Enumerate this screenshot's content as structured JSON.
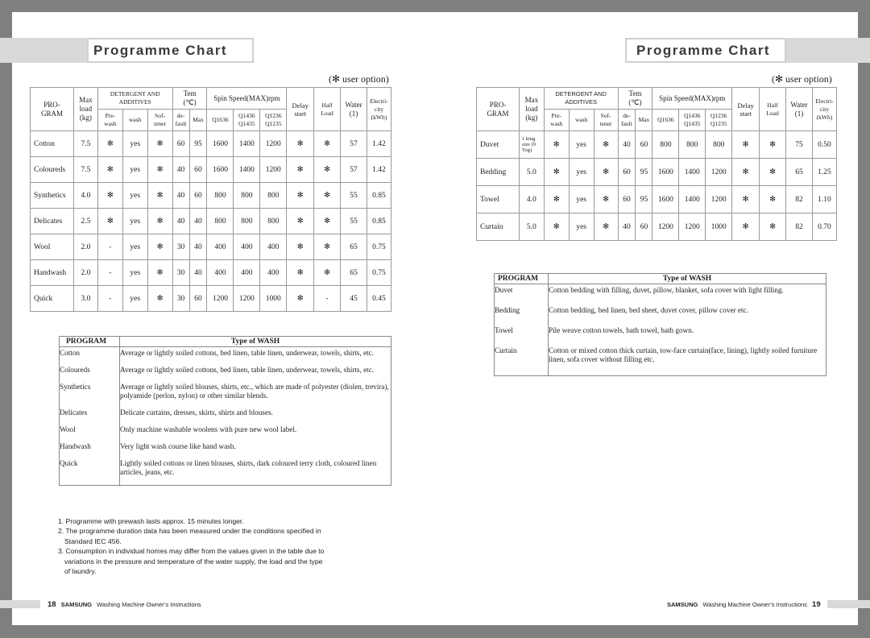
{
  "left_page": {
    "title": "Programme Chart",
    "user_option": "(✻ user option)",
    "header": {
      "program": "PRO-\nGRAM",
      "max_load": "Max load (kg)",
      "detergent": "DETERGENT AND ADDITIVES",
      "prewash": "Pre- wash",
      "wash": "wash",
      "softener": "Sof- tener",
      "temp": "Tem (℃)",
      "default": "de- fault",
      "max": "Max",
      "spin": "Spin Speed(MAX)rpm",
      "q1636": "Q1636",
      "q1436": "Q1436 Q1435",
      "q1236": "Q1236 Q1235",
      "delay": "Delay start",
      "half": "Half Load",
      "water": "Water (1)",
      "electricity": "Electri- city (kWh)"
    },
    "rows": [
      {
        "program": "Cotton",
        "load": "7.5",
        "prewash": "✻",
        "wash": "yes",
        "softener": "✻",
        "t_default": "60",
        "t_max": "95",
        "q1636": "1600",
        "q1436": "1400",
        "q1236": "1200",
        "delay": "✻",
        "half": "✻",
        "water": "57",
        "elec": "1.42"
      },
      {
        "program": "Coloureds",
        "load": "7.5",
        "prewash": "✻",
        "wash": "yes",
        "softener": "✻",
        "t_default": "40",
        "t_max": "60",
        "q1636": "1600",
        "q1436": "1400",
        "q1236": "1200",
        "delay": "✻",
        "half": "✻",
        "water": "57",
        "elec": "1.42"
      },
      {
        "program": "Synthetics",
        "load": "4.0",
        "prewash": "✻",
        "wash": "yes",
        "softener": "✻",
        "t_default": "40",
        "t_max": "60",
        "q1636": "800",
        "q1436": "800",
        "q1236": "800",
        "delay": "✻",
        "half": "✻",
        "water": "55",
        "elec": "0.85"
      },
      {
        "program": "Delicates",
        "load": "2.5",
        "prewash": "✻",
        "wash": "yes",
        "softener": "✻",
        "t_default": "40",
        "t_max": "40",
        "q1636": "800",
        "q1436": "800",
        "q1236": "800",
        "delay": "✻",
        "half": "✻",
        "water": "55",
        "elec": "0.85"
      },
      {
        "program": "Wool",
        "load": "2.0",
        "prewash": "-",
        "wash": "yes",
        "softener": "✻",
        "t_default": "30",
        "t_max": "40",
        "q1636": "400",
        "q1436": "400",
        "q1236": "400",
        "delay": "✻",
        "half": "✻",
        "water": "65",
        "elec": "0.75"
      },
      {
        "program": "Handwash",
        "load": "2.0",
        "prewash": "-",
        "wash": "yes",
        "softener": "✻",
        "t_default": "30",
        "t_max": "40",
        "q1636": "400",
        "q1436": "400",
        "q1236": "400",
        "delay": "✻",
        "half": "✻",
        "water": "65",
        "elec": "0.75"
      },
      {
        "program": "Quick",
        "load": "3.0",
        "prewash": "-",
        "wash": "yes",
        "softener": "✻",
        "t_default": "30",
        "t_max": "60",
        "q1636": "1200",
        "q1436": "1200",
        "q1236": "1000",
        "delay": "✻",
        "half": "-",
        "water": "45",
        "elec": "0.45"
      }
    ],
    "wash_table": {
      "col_program": "PROGRAM",
      "col_type": "Type of  WASH",
      "rows": [
        {
          "program": "Cotton",
          "desc": "Average or lightly soiled cottons, bed linen, table linen, underwear, towels, shirts, etc."
        },
        {
          "program": "Coloureds",
          "desc": "Average or lightly soiled cottons, bed linen, table linen, underwear, towels, shirts, etc."
        },
        {
          "program": "Synthetics",
          "desc": "Average or lightly soiled blouses, shirts, etc., which are made of polyester (diolen, trevira), polyamide (perlon, nylon) or other similar blends."
        },
        {
          "program": "Delicates",
          "desc": "Delicate curtains, dresses, skirts, shirts and blouses."
        },
        {
          "program": "Wool",
          "desc": "Only machine washable woolens with pure new wool label."
        },
        {
          "program": "Handwash",
          "desc": "Very light wash course like hand wash."
        },
        {
          "program": "Quick",
          "desc": "Lightly soiled cottons or linen blouses, shirts, dark coloured terry cloth, coloured linen articles, jeans, etc."
        }
      ]
    },
    "notes": [
      "1. Programme with prewash lasts approx. 15 minutes longer.",
      "2. The programme duration data has been measured under the conditions specified in Standard IEC 456.",
      "3. Consumption in individual homes may differ from the values given in the table due to variations in the pressure and temperature of the water supply, the load and the type of laundry."
    ],
    "footer": {
      "page": "18",
      "brand": "SAMSUNG",
      "text": "Washing Machine Owner’s Instructions"
    }
  },
  "right_page": {
    "title": "Programme Chart",
    "user_option": "(✻ user option)",
    "rows": [
      {
        "program": "Duvet",
        "load": "1 king size (9 Tog)",
        "prewash": "✻",
        "wash": "yes",
        "softener": "✻",
        "t_default": "40",
        "t_max": "60",
        "q1636": "800",
        "q1436": "800",
        "q1236": "800",
        "delay": "✻",
        "half": "✻",
        "water": "75",
        "elec": "0.50"
      },
      {
        "program": "Bedding",
        "load": "5.0",
        "prewash": "✻",
        "wash": "yes",
        "softener": "✻",
        "t_default": "60",
        "t_max": "95",
        "q1636": "1600",
        "q1436": "1400",
        "q1236": "1200",
        "delay": "✻",
        "half": "✻",
        "water": "65",
        "elec": "1.25"
      },
      {
        "program": "Towel",
        "load": "4.0",
        "prewash": "✻",
        "wash": "yes",
        "softener": "✻",
        "t_default": "60",
        "t_max": "95",
        "q1636": "1600",
        "q1436": "1400",
        "q1236": "1200",
        "delay": "✻",
        "half": "✻",
        "water": "82",
        "elec": "1.10"
      },
      {
        "program": "Curtain",
        "load": "5.0",
        "prewash": "✻",
        "wash": "yes",
        "softener": "✻",
        "t_default": "40",
        "t_max": "60",
        "q1636": "1200",
        "q1436": "1200",
        "q1236": "1000",
        "delay": "✻",
        "half": "✻",
        "water": "82",
        "elec": "0.70"
      }
    ],
    "wash_table": {
      "col_program": "PROGRAM",
      "col_type": "Type of  WASH",
      "rows": [
        {
          "program": "Duvet",
          "desc": "Cotton bedding with filling, duvet, pillow, blanket, sofa cover with light filling."
        },
        {
          "program": "Bedding",
          "desc": "Cotton bedding, bed linen, bed sheet, duvet cover, pillow cover etc."
        },
        {
          "program": "Towel",
          "desc": "Pile weave cotton towels, bath towel, bath gown."
        },
        {
          "program": "Curtain",
          "desc": "Cotton or mixed cotton thick curtain, tow-face curtain(face, lining), lightly soiled furniture linen, sofa cover without filling etc."
        }
      ]
    },
    "footer": {
      "page": "19",
      "brand": "SAMSUNG",
      "text": "Washing Machine Owner’s Instructions"
    }
  }
}
